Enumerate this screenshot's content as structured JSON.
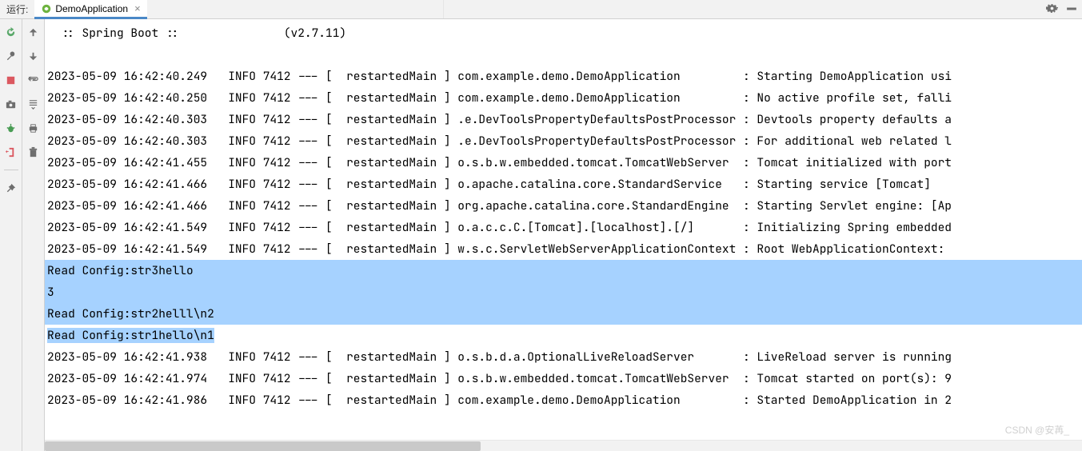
{
  "header": {
    "run_label": "运行:",
    "tab_label": "DemoApplication"
  },
  "console": {
    "banner": "  :: Spring Boot ::               (v2.7.11)",
    "logs": [
      {
        "ts": "2023-05-09 16:42:40.249",
        "level": "INFO",
        "pid": "7412",
        "thread": "restartedMain",
        "logger": "com.example.demo.DemoApplication",
        "msg": "Starting DemoApplication usi"
      },
      {
        "ts": "2023-05-09 16:42:40.250",
        "level": "INFO",
        "pid": "7412",
        "thread": "restartedMain",
        "logger": "com.example.demo.DemoApplication",
        "msg": "No active profile set, falli"
      },
      {
        "ts": "2023-05-09 16:42:40.303",
        "level": "INFO",
        "pid": "7412",
        "thread": "restartedMain",
        "logger": ".e.DevToolsPropertyDefaultsPostProcessor",
        "msg": "Devtools property defaults a"
      },
      {
        "ts": "2023-05-09 16:42:40.303",
        "level": "INFO",
        "pid": "7412",
        "thread": "restartedMain",
        "logger": ".e.DevToolsPropertyDefaultsPostProcessor",
        "msg": "For additional web related l"
      },
      {
        "ts": "2023-05-09 16:42:41.455",
        "level": "INFO",
        "pid": "7412",
        "thread": "restartedMain",
        "logger": "o.s.b.w.embedded.tomcat.TomcatWebServer",
        "msg": "Tomcat initialized with port"
      },
      {
        "ts": "2023-05-09 16:42:41.466",
        "level": "INFO",
        "pid": "7412",
        "thread": "restartedMain",
        "logger": "o.apache.catalina.core.StandardService",
        "msg": "Starting service [Tomcat]"
      },
      {
        "ts": "2023-05-09 16:42:41.466",
        "level": "INFO",
        "pid": "7412",
        "thread": "restartedMain",
        "logger": "org.apache.catalina.core.StandardEngine",
        "msg": "Starting Servlet engine: [Ap"
      },
      {
        "ts": "2023-05-09 16:42:41.549",
        "level": "INFO",
        "pid": "7412",
        "thread": "restartedMain",
        "logger": "o.a.c.c.C.[Tomcat].[localhost].[/]",
        "msg": "Initializing Spring embedded"
      },
      {
        "ts": "2023-05-09 16:42:41.549",
        "level": "INFO",
        "pid": "7412",
        "thread": "restartedMain",
        "logger": "w.s.c.ServletWebServerApplicationContext",
        "msg": "Root WebApplicationContext:"
      }
    ],
    "highlighted": [
      "Read Config:str3hello",
      "3",
      "Read Config:str2helll\\n2",
      "Read Config:str1hello\\n1"
    ],
    "logs_after": [
      {
        "ts": "2023-05-09 16:42:41.938",
        "level": "INFO",
        "pid": "7412",
        "thread": "restartedMain",
        "logger": "o.s.b.d.a.OptionalLiveReloadServer",
        "msg": "LiveReload server is running"
      },
      {
        "ts": "2023-05-09 16:42:41.974",
        "level": "INFO",
        "pid": "7412",
        "thread": "restartedMain",
        "logger": "o.s.b.w.embedded.tomcat.TomcatWebServer",
        "msg": "Tomcat started on port(s): 9"
      },
      {
        "ts": "2023-05-09 16:42:41.986",
        "level": "INFO",
        "pid": "7412",
        "thread": "restartedMain",
        "logger": "com.example.demo.DemoApplication",
        "msg": "Started DemoApplication in 2"
      }
    ]
  },
  "watermark": "CSDN @安苒_"
}
